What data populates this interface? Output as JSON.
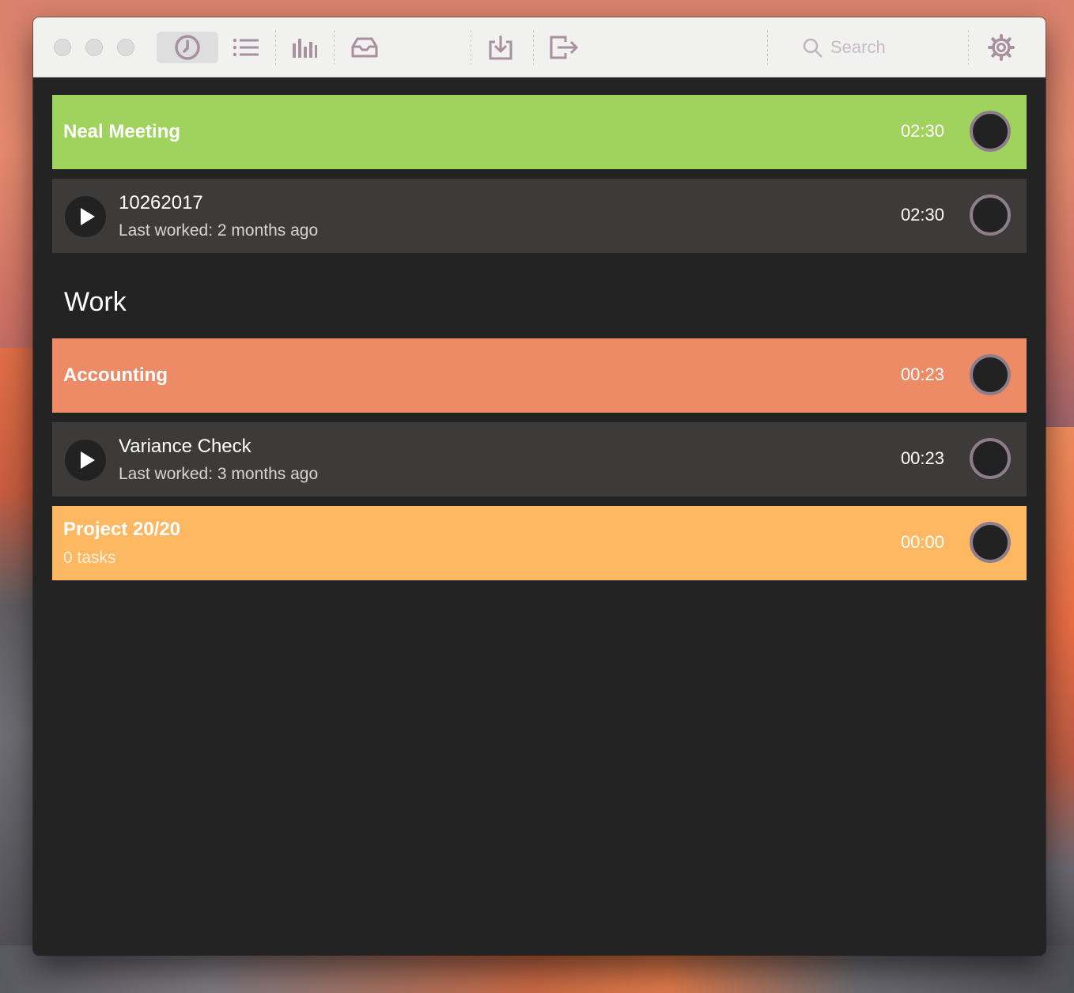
{
  "colors": {
    "green": "#a0d35e",
    "orange": "#ee8b67",
    "yellow": "#ffb862",
    "task_bg": "#3d3b3a",
    "window_bg": "#232323",
    "toolbar_bg": "#f1f1f0",
    "icon_tint": "#a8909e"
  },
  "toolbar": {
    "icons": [
      "timer-icon",
      "list-icon",
      "bar-chart-icon",
      "inbox-icon",
      "import-icon",
      "export-icon",
      "search-icon",
      "gear-icon"
    ],
    "search_placeholder": "Search"
  },
  "projects_ungrouped": [
    {
      "title": "Neal Meeting",
      "time": "02:30",
      "color": "#a0d35e",
      "tasks": [
        {
          "title": "10262017",
          "last_worked": "Last worked: 2 months ago",
          "time": "02:30"
        }
      ]
    }
  ],
  "groups": [
    {
      "title": "Work",
      "projects": [
        {
          "title": "Accounting",
          "time": "00:23",
          "color": "#ee8b67",
          "tasks": [
            {
              "title": "Variance Check",
              "last_worked": "Last worked: 3 months ago",
              "time": "00:23"
            }
          ]
        },
        {
          "title": "Project 20/20",
          "subtitle": "0 tasks",
          "time": "00:00",
          "color": "#ffb862",
          "tasks": []
        }
      ]
    }
  ]
}
